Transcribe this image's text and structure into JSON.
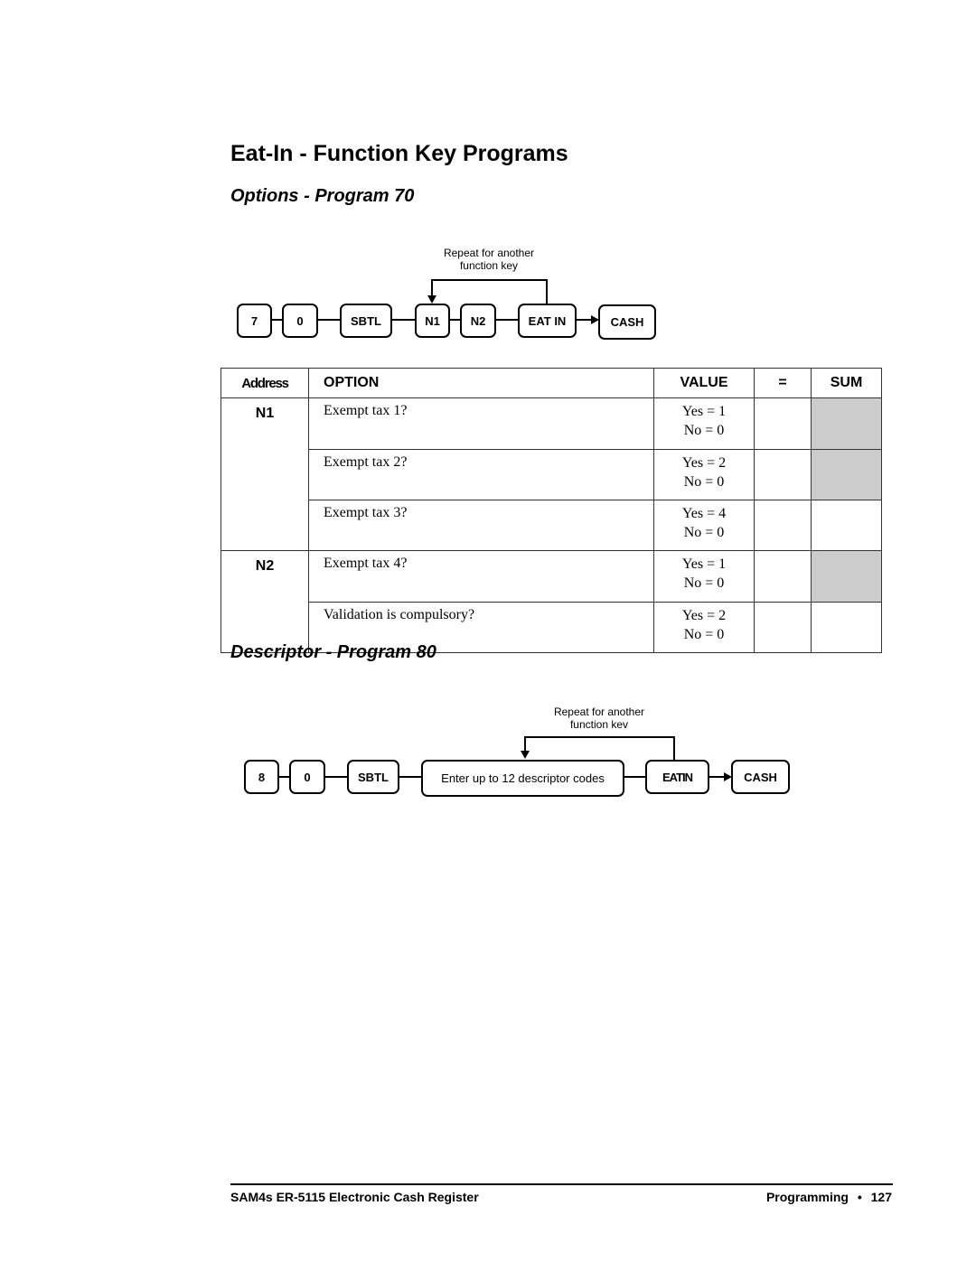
{
  "page": {
    "title": "Eat-In - Function Key Programs"
  },
  "options_program": {
    "heading": "Options - Program 70",
    "flow_note_line1": "Repeat for another",
    "flow_note_line2": "function key",
    "keys": [
      "7",
      "0",
      "SBTL",
      "N1",
      "N2",
      "EAT IN",
      "CASH"
    ],
    "table": {
      "headers": {
        "address": "Address",
        "option": "OPTION",
        "value": "VALUE",
        "equals": "=",
        "sum": "SUM"
      },
      "rows": [
        {
          "address": "N1",
          "option": "Exempt tax 1?",
          "yes": "Yes = 1",
          "no": "No = 0",
          "sum_shaded": true
        },
        {
          "address": "",
          "option": "Exempt tax 2?",
          "yes": "Yes = 2",
          "no": "No = 0",
          "sum_shaded": true
        },
        {
          "address": "",
          "option": "Exempt tax 3?",
          "yes": "Yes = 4",
          "no": "No = 0",
          "sum_shaded": false
        },
        {
          "address": "N2",
          "option": "Exempt tax 4?",
          "yes": "Yes = 1",
          "no": "No = 0",
          "sum_shaded": true
        },
        {
          "address": "",
          "option": "Validation is compulsory?",
          "yes": "Yes = 2",
          "no": "No = 0",
          "sum_shaded": false
        }
      ]
    }
  },
  "descriptor_program": {
    "heading": "Descriptor - Program 80",
    "flow_note_line1": "Repeat for another",
    "flow_note_line2": "function kev",
    "keys": [
      "8",
      "0",
      "SBTL",
      "Enter up to 12 descriptor codes",
      "EATIN",
      "CASH"
    ]
  },
  "footer": {
    "left": "SAM4s ER-5115 Electronic Cash Register",
    "section": "Programming",
    "bullet": "•",
    "page_number": "127"
  },
  "colors": {
    "shaded_cell": "#cccccc",
    "text": "#000000"
  }
}
